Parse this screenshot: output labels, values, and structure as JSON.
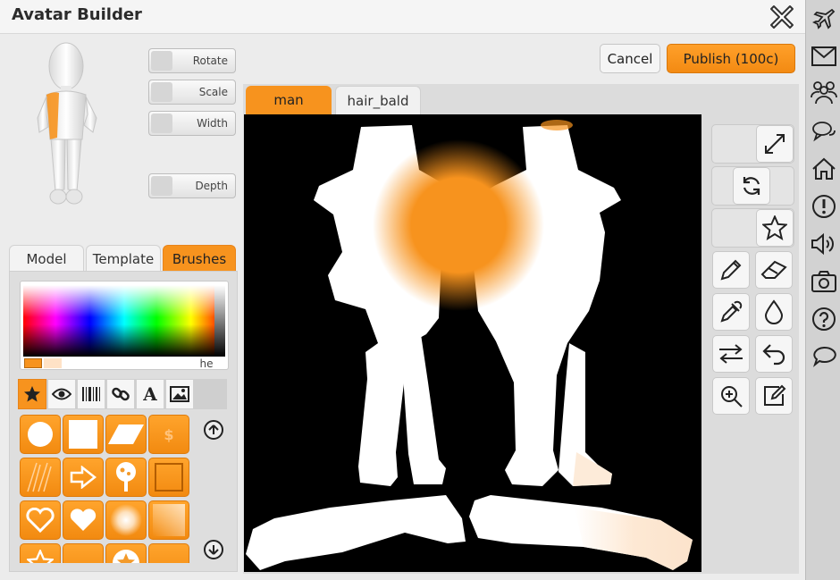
{
  "window": {
    "title": "Avatar Builder"
  },
  "transform_controls": [
    {
      "label": "Rotate"
    },
    {
      "label": "Scale"
    },
    {
      "label": "Width"
    },
    {
      "label": "Depth"
    }
  ],
  "left_tabs": [
    {
      "label": "Model",
      "active": false
    },
    {
      "label": "Template",
      "active": false
    },
    {
      "label": "Brushes",
      "active": true
    }
  ],
  "color_picker": {
    "hex_value": "he",
    "primary_color": "#f7931e",
    "secondary_color": "#ffe2c6"
  },
  "brush_category_tabs": [
    "star-icon",
    "eye-icon",
    "barcode-icon",
    "link-icon",
    "text-icon",
    "image-icon"
  ],
  "brushes": [
    "circle-brush-icon",
    "square-brush-icon",
    "parallelogram-brush-icon",
    "dollar-brush-icon",
    "scratch-brush-icon",
    "arrow-brush-icon",
    "tree-brush-icon",
    "square-outline-brush-icon",
    "heart-outline-brush-icon",
    "heart-brush-icon",
    "soft-circle-brush-icon",
    "gradient-brush-icon",
    "star-outline-brush-icon",
    "blank-brush-icon",
    "star-badge-brush-icon",
    "texture-brush-icon"
  ],
  "actions": {
    "cancel": "Cancel",
    "publish": "Publish (100c)"
  },
  "canvas_tabs": [
    {
      "label": "man",
      "active": true
    },
    {
      "label": "hair_bald",
      "active": false
    }
  ],
  "tools": [
    "expand-icon",
    "refresh-icon",
    "star-icon",
    "pencil-icon",
    "eraser-icon",
    "eyedropper-icon",
    "drop-icon",
    "swap-icon",
    "undo-icon",
    "zoom-in-icon",
    "edit-icon"
  ],
  "sidebar_icons": [
    "airplane-icon",
    "mail-icon",
    "friends-icon",
    "chat-icon",
    "home-icon",
    "alert-icon",
    "sound-icon",
    "camera-icon",
    "help-icon",
    "comment-icon"
  ],
  "colors": {
    "accent": "#f7931e",
    "canvas_bg": "#000000"
  }
}
